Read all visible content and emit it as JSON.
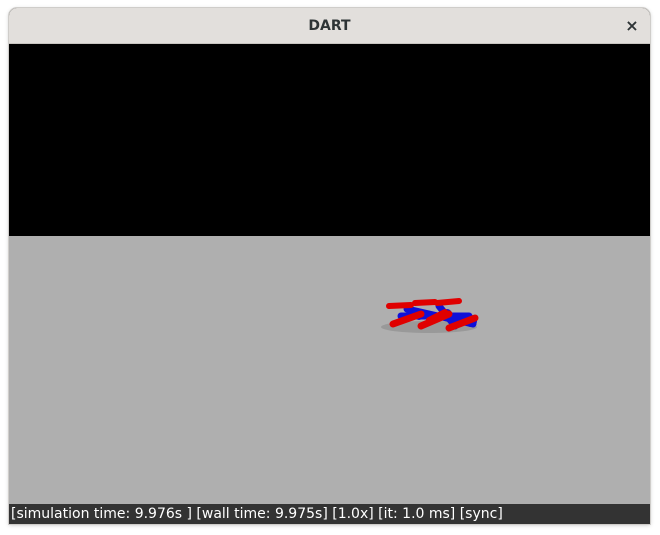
{
  "window": {
    "title": "DART",
    "close_glyph": "×"
  },
  "viewport": {
    "sky_color": "#000000",
    "ground_color": "#afafaf",
    "robot_link_color": "#e00000",
    "robot_joint_color": "#1010d8"
  },
  "statusbar": {
    "text": "[simulation time: 9.976s ] [wall time: 9.975s] [1.0x] [it: 1.0 ms] [sync]"
  }
}
